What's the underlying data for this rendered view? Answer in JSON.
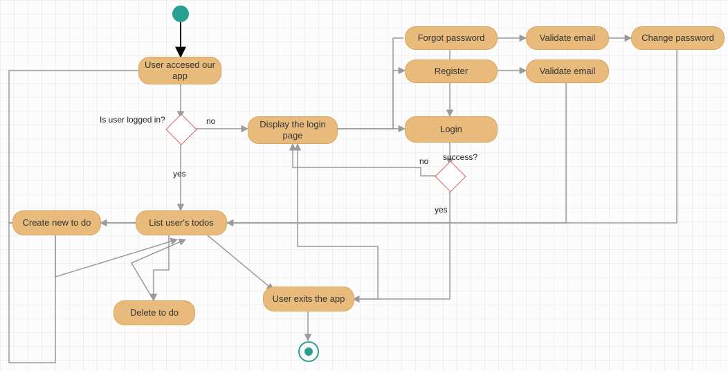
{
  "nodes": {
    "user_accessed": "User accesed our app",
    "display_login": "Display the login page",
    "forgot_password": "Forgot password",
    "validate_email_1": "Validate email",
    "change_password": "Change password",
    "register": "Register",
    "validate_email_2": "Validate email",
    "login": "Login",
    "list_todos": "List user's todos",
    "create_todo": "Create new to do",
    "delete_todo": "Delete to do",
    "user_exits": "User exits the app"
  },
  "labels": {
    "is_logged_in": "Is user logged in?",
    "no1": "no",
    "yes1": "yes",
    "success": "success?",
    "no2": "no",
    "yes2": "yes"
  }
}
